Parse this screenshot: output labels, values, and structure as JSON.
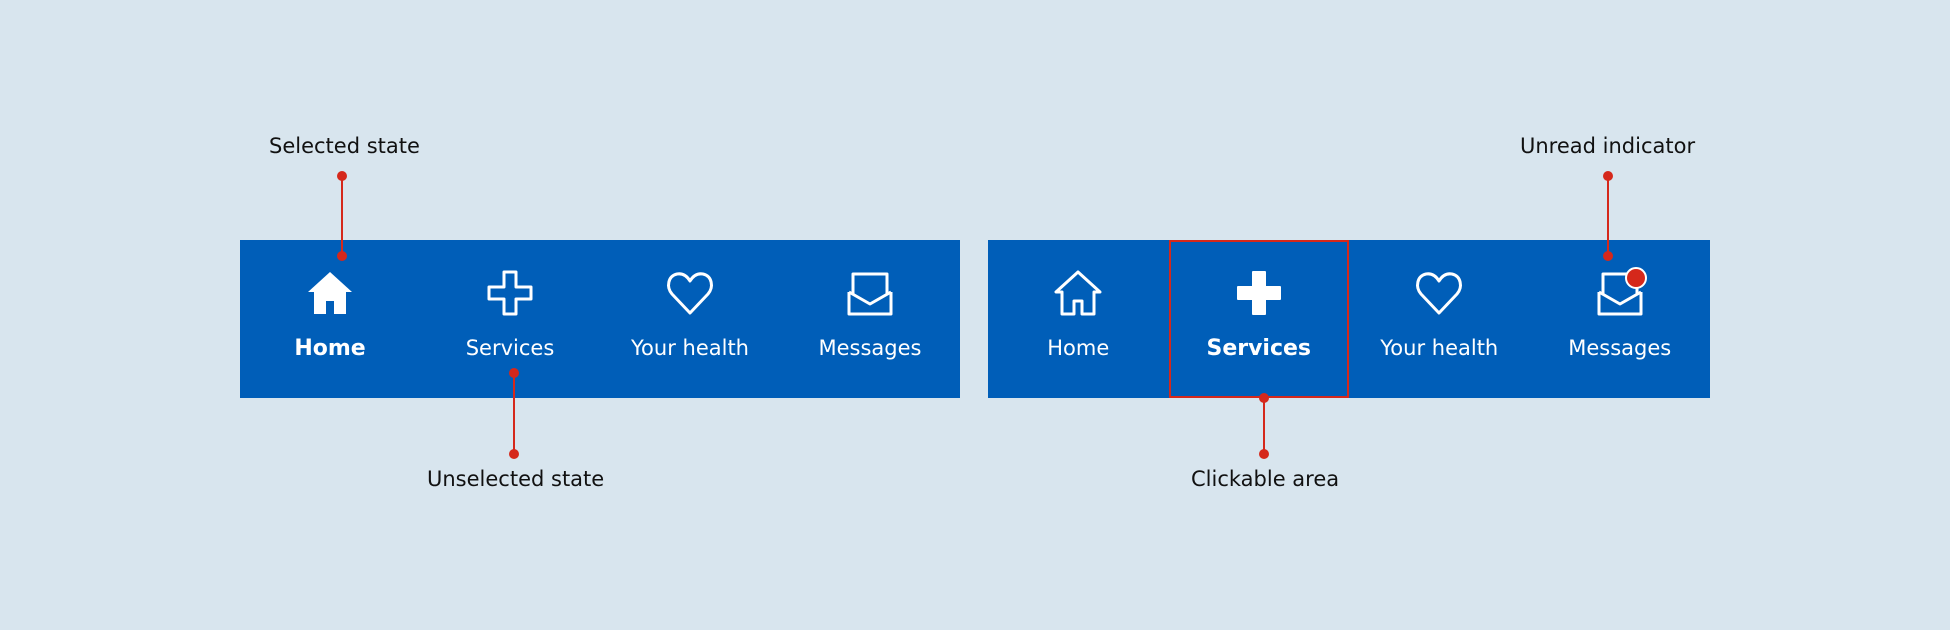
{
  "colors": {
    "background": "#d8e5ee",
    "nav_bar": "#005eb8",
    "nav_text": "#ffffff",
    "annotation_accent": "#d5281b",
    "annotation_text": "#111111"
  },
  "left_nav": {
    "items": [
      {
        "label": "Home",
        "icon": "home-icon",
        "state": "selected"
      },
      {
        "label": "Services",
        "icon": "services-cross-icon",
        "state": "unselected"
      },
      {
        "label": "Your health",
        "icon": "heart-icon",
        "state": "unselected"
      },
      {
        "label": "Messages",
        "icon": "envelope-icon",
        "state": "unselected"
      }
    ]
  },
  "right_nav": {
    "items": [
      {
        "label": "Home",
        "icon": "home-icon",
        "state": "unselected"
      },
      {
        "label": "Services",
        "icon": "services-cross-icon",
        "state": "selected"
      },
      {
        "label": "Your health",
        "icon": "heart-icon",
        "state": "unselected"
      },
      {
        "label": "Messages",
        "icon": "envelope-icon",
        "state": "unselected",
        "unread": true
      }
    ]
  },
  "annotations": {
    "selected_state": "Selected state",
    "unselected_state": "Unselected state",
    "clickable_area": "Clickable area",
    "unread_indicator": "Unread indicator"
  }
}
